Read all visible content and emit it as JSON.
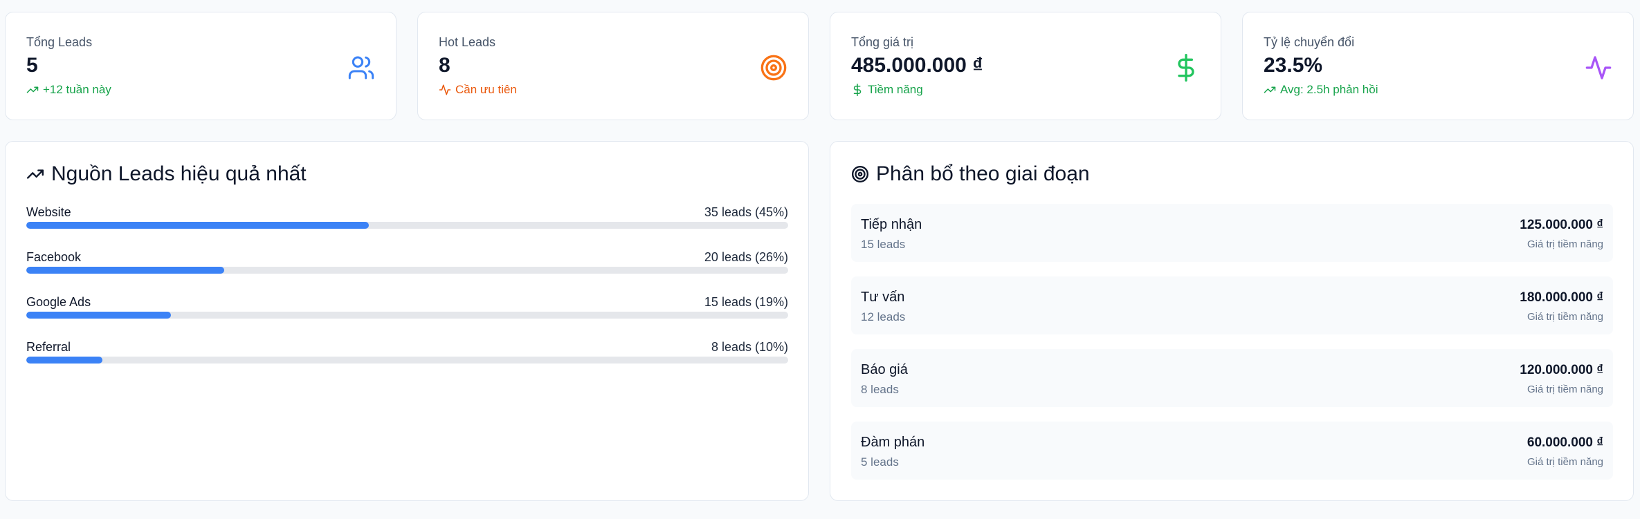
{
  "stats": [
    {
      "label": "Tổng Leads",
      "value": "5",
      "sub": "+12 tuần này",
      "sub_color": "#16a34a",
      "icon": "users-icon",
      "icon_color": "#3b82f6",
      "sub_icon": "trending-up-icon"
    },
    {
      "label": "Hot Leads",
      "value": "8",
      "sub": "Cần ưu tiên",
      "sub_color": "#ea580c",
      "icon": "target-icon",
      "icon_color": "#f97316",
      "sub_icon": "activity-icon"
    },
    {
      "label": "Tổng giá trị",
      "value": "485.000.000 ₫",
      "sub": "Tiềm năng",
      "sub_color": "#16a34a",
      "icon": "dollar-icon",
      "icon_color": "#22c55e",
      "sub_icon": "dollar-icon"
    },
    {
      "label": "Tỷ lệ chuyển đổi",
      "value": "23.5%",
      "sub": "Avg: 2.5h phản hồi",
      "sub_color": "#16a34a",
      "icon": "activity-icon",
      "icon_color": "#a855f7",
      "sub_icon": "trending-up-icon"
    }
  ],
  "sources": {
    "title": "Nguồn Leads hiệu quả nhất",
    "items": [
      {
        "name": "Website",
        "count": "35 leads (45%)",
        "pct": 45
      },
      {
        "name": "Facebook",
        "count": "20 leads (26%)",
        "pct": 26
      },
      {
        "name": "Google Ads",
        "count": "15 leads (19%)",
        "pct": 19
      },
      {
        "name": "Referral",
        "count": "8 leads (10%)",
        "pct": 10
      }
    ],
    "bar_color": "#3b82f6"
  },
  "stages": {
    "title": "Phân bổ theo giai đoạn",
    "items": [
      {
        "name": "Tiếp nhận",
        "leads": "15 leads",
        "value": "125.000.000 ₫",
        "note": "Giá trị tiềm năng"
      },
      {
        "name": "Tư vấn",
        "leads": "12 leads",
        "value": "180.000.000 ₫",
        "note": "Giá trị tiềm năng"
      },
      {
        "name": "Báo giá",
        "leads": "8 leads",
        "value": "120.000.000 ₫",
        "note": "Giá trị tiềm năng"
      },
      {
        "name": "Đàm phán",
        "leads": "5 leads",
        "value": "60.000.000 ₫",
        "note": "Giá trị tiềm năng"
      }
    ]
  }
}
